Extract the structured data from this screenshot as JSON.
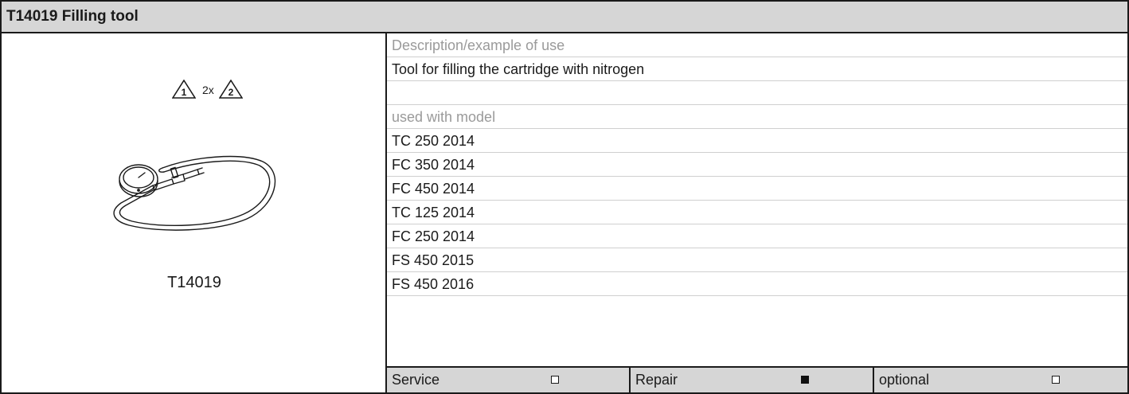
{
  "title": "T14019 Filling tool",
  "illustration": {
    "warning_icon_1": "1",
    "repeat_count": "2x",
    "warning_icon_2": "2",
    "part_number": "T14019"
  },
  "description": {
    "heading": "Description/example of use",
    "text": "Tool for filling the cartridge with nitrogen"
  },
  "models": {
    "heading": "used with model",
    "items": [
      "TC 250 2014",
      "FC 350 2014",
      "FC 450 2014",
      "TC 125 2014",
      "FC 250 2014",
      "FS 450 2015",
      "FS 450 2016"
    ]
  },
  "usage": [
    {
      "label": "Service",
      "checked": false
    },
    {
      "label": "Repair",
      "checked": true
    },
    {
      "label": "optional",
      "checked": false
    }
  ],
  "icons": {
    "warning": "warning-triangle-icon",
    "checkbox_empty": "checkbox-empty-icon",
    "checkbox_filled": "checkbox-filled-icon"
  }
}
